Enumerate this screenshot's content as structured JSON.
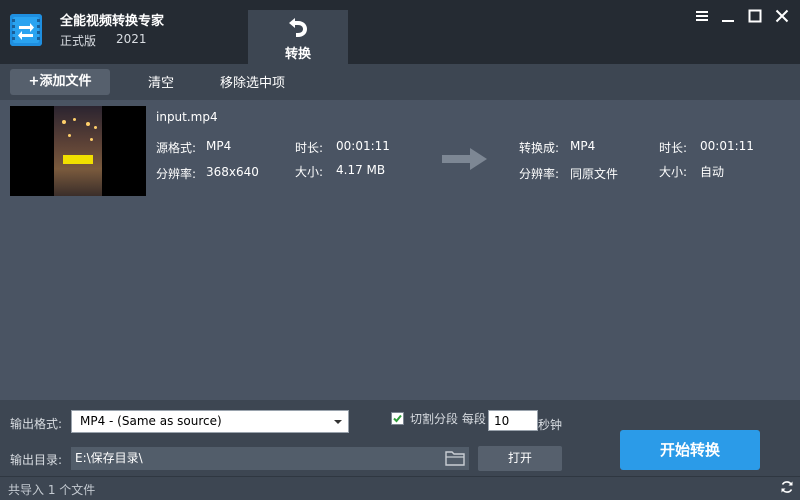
{
  "app": {
    "title": "全能视频转换专家",
    "edition": "正式版",
    "year": "2021",
    "logo_icon": "convert-arrows-icon",
    "accent_color": "#2b9be8"
  },
  "tabs": [
    {
      "label": "转换",
      "icon": "rotate-arrow-icon",
      "active": true
    }
  ],
  "window_controls": [
    "pin-icon",
    "minimize-icon",
    "maximize-icon",
    "close-icon"
  ],
  "toolbar": {
    "add_label": "+添加文件",
    "clear_label": "清空",
    "remove_label": "移除选中项"
  },
  "files": [
    {
      "name": "input.mp4",
      "source": {
        "format_label": "源格式:",
        "format": "MP4",
        "resolution_label": "分辨率:",
        "resolution": "368x640",
        "duration_label": "时长:",
        "duration": "00:01:11",
        "size_label": "大小:",
        "size": "4.17 MB"
      },
      "target": {
        "format_label": "转换成:",
        "format": "MP4",
        "resolution_label": "分辨率:",
        "resolution": "同原文件",
        "duration_label": "时长:",
        "duration": "00:01:11",
        "size_label": "大小:",
        "size": "自动"
      }
    }
  ],
  "output": {
    "format_label": "输出格式:",
    "format_value": "MP4 - (Same as source)",
    "dir_label": "输出目录:",
    "dir_value": "E:\\保存目录\\",
    "open_label": "打开",
    "split": {
      "checked": true,
      "label": "切割分段 每段",
      "value": "10",
      "unit": "秒钟"
    },
    "start_label": "开始转换"
  },
  "status": {
    "text": "共导入 1 个文件"
  }
}
